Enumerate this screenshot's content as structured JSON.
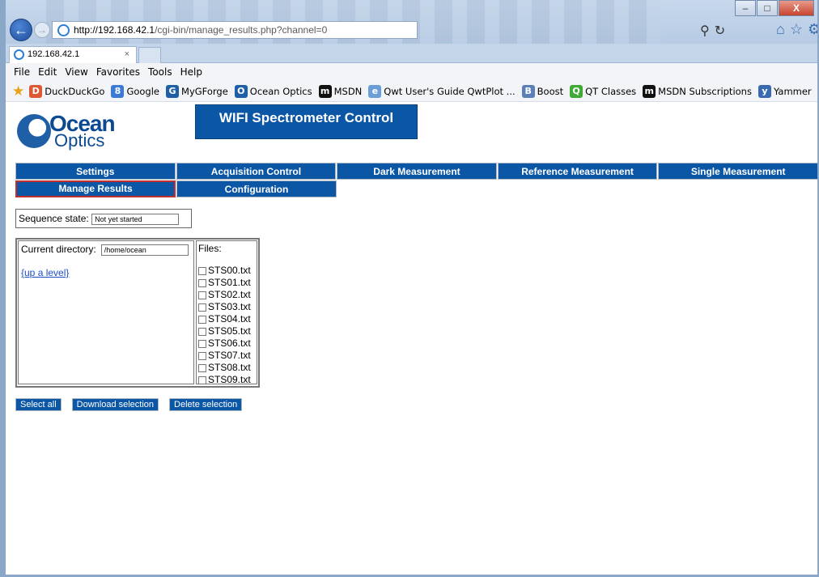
{
  "browser": {
    "url_host": "http://192.168.42.1",
    "url_path": "/cgi-bin/manage_results.php?channel=0",
    "tab_title": "192.168.42.1",
    "tab_close": "×",
    "menu": [
      "File",
      "Edit",
      "View",
      "Favorites",
      "Tools",
      "Help"
    ],
    "favorites": [
      {
        "label": "DuckDuckGo",
        "icon": "duckduckgo-icon",
        "color": "#de5833",
        "glyph": "D"
      },
      {
        "label": "Google",
        "icon": "google-icon",
        "color": "#3b7bd8",
        "glyph": "8"
      },
      {
        "label": "MyGForge",
        "icon": "gforge-icon",
        "color": "#1f5fa6",
        "glyph": "G"
      },
      {
        "label": "Ocean Optics",
        "icon": "ocean-optics-icon",
        "color": "#1f5fa6",
        "glyph": "O"
      },
      {
        "label": "MSDN",
        "icon": "msdn-icon",
        "color": "#111111",
        "glyph": "m"
      },
      {
        "label": "Qwt User's Guide QwtPlot ...",
        "icon": "ie-page-icon",
        "color": "#6a9ed8",
        "glyph": "e"
      },
      {
        "label": "Boost",
        "icon": "boost-icon",
        "color": "#5b7fb8",
        "glyph": "B"
      },
      {
        "label": "QT Classes",
        "icon": "qt-icon",
        "color": "#41a935",
        "glyph": "Q"
      },
      {
        "label": "MSDN Subscriptions",
        "icon": "msdn-icon",
        "color": "#111111",
        "glyph": "m"
      },
      {
        "label": "Yammer",
        "icon": "yammer-icon",
        "color": "#396ab1",
        "glyph": "y"
      }
    ],
    "window_controls": {
      "minimize": "–",
      "maximize": "□",
      "close": "X"
    }
  },
  "page": {
    "logo": {
      "line1": "Ocean",
      "line2": "Optics"
    },
    "title": "WIFI Spectrometer Control",
    "nav_row1": [
      "Settings",
      "Acquisition Control",
      "Dark Measurement",
      "Reference Measurement",
      "Single Measurement"
    ],
    "nav_row2": [
      "Manage Results",
      "Configuration"
    ],
    "sequence_label": "Sequence state:",
    "sequence_value": "Not yet started",
    "current_dir_label": "Current directory:",
    "current_dir_value": "/home/ocean",
    "up_level": "{up a level}",
    "files_label": "Files:",
    "files": [
      "STS00.txt",
      "STS01.txt",
      "STS02.txt",
      "STS03.txt",
      "STS04.txt",
      "STS05.txt",
      "STS06.txt",
      "STS07.txt",
      "STS08.txt",
      "STS09.txt"
    ],
    "actions": [
      "Select all",
      "Download selection",
      "Delete selection"
    ],
    "accent_color": "#0b57a6",
    "active_border_color": "#c0302e"
  }
}
